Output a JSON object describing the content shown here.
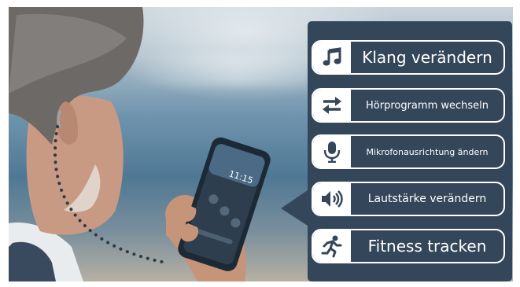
{
  "features": [
    {
      "icon": "music-note-icon",
      "label": "Klang verändern"
    },
    {
      "icon": "swap-arrows-icon",
      "label": "Hörprogramm wechseln"
    },
    {
      "icon": "microphone-icon",
      "label": "Mikrofonausrichtung ändern"
    },
    {
      "icon": "speaker-icon",
      "label": "Lautstärke verändern"
    },
    {
      "icon": "running-person-icon",
      "label": "Fitness tracken"
    }
  ],
  "phone": {
    "clock": "11:15"
  },
  "colors": {
    "panel": "#34465a",
    "icon": "#34465a",
    "text": "#ffffff"
  }
}
